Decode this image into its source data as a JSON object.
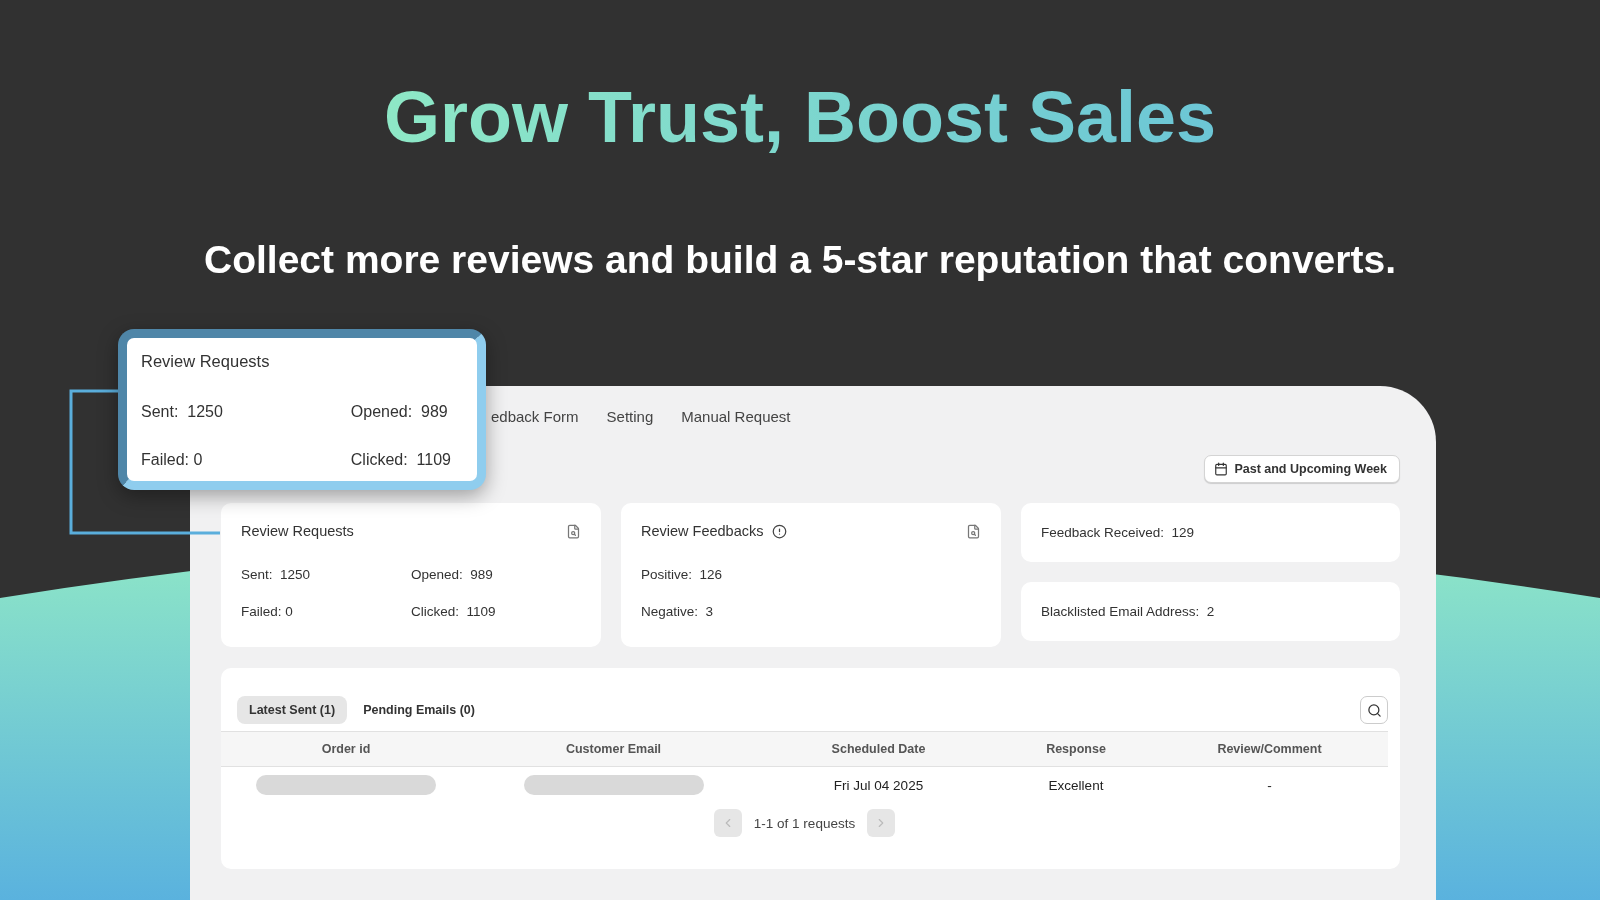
{
  "hero": {
    "title": "Grow Trust, Boost Sales",
    "subtitle": "Collect more reviews and build a 5-star reputation that converts."
  },
  "callout": {
    "title": "Review Requests",
    "stats": [
      {
        "label": "Sent:",
        "value": "1250"
      },
      {
        "label": "Opened:",
        "value": "989"
      },
      {
        "label": "Failed: 0"
      },
      {
        "label": "Clicked:",
        "value": "1109"
      }
    ]
  },
  "app": {
    "nav_items": [
      "edback Form",
      "Setting",
      "Manual Request"
    ],
    "date_filter": "Past and Upcoming Week",
    "requests_card": {
      "title": "Review Requests",
      "stats": [
        {
          "label": "Sent:",
          "value": "1250"
        },
        {
          "label": "Opened:",
          "value": "989"
        },
        {
          "label": "Failed: 0"
        },
        {
          "label": "Clicked:",
          "value": "1109"
        }
      ]
    },
    "feedbacks_card": {
      "title": "Review Feedbacks",
      "stats": [
        {
          "label": "Positive:",
          "value": "126"
        },
        {
          "label": "Negative:",
          "value": "3"
        }
      ]
    },
    "summary": [
      {
        "label": "Feedback Received:",
        "value": "129"
      },
      {
        "label": "Blacklisted Email Address:",
        "value": "2"
      }
    ],
    "table": {
      "tabs": [
        {
          "label": "Latest Sent (1)",
          "selected": true
        },
        {
          "label": "Pending Emails (0)",
          "selected": false
        }
      ],
      "columns": [
        "Order id",
        "Customer Email",
        "Scheduled Date",
        "Response",
        "Review/Comment"
      ],
      "rows": [
        {
          "cells": [
            {
              "kind": "redacted"
            },
            {
              "kind": "redacted"
            },
            {
              "kind": "text",
              "text": "Fri Jul 04 2025"
            },
            {
              "kind": "text",
              "text": "Excellent"
            },
            {
              "kind": "text",
              "text": "-"
            }
          ]
        }
      ],
      "pagination": "1-1 of 1 requests"
    }
  }
}
